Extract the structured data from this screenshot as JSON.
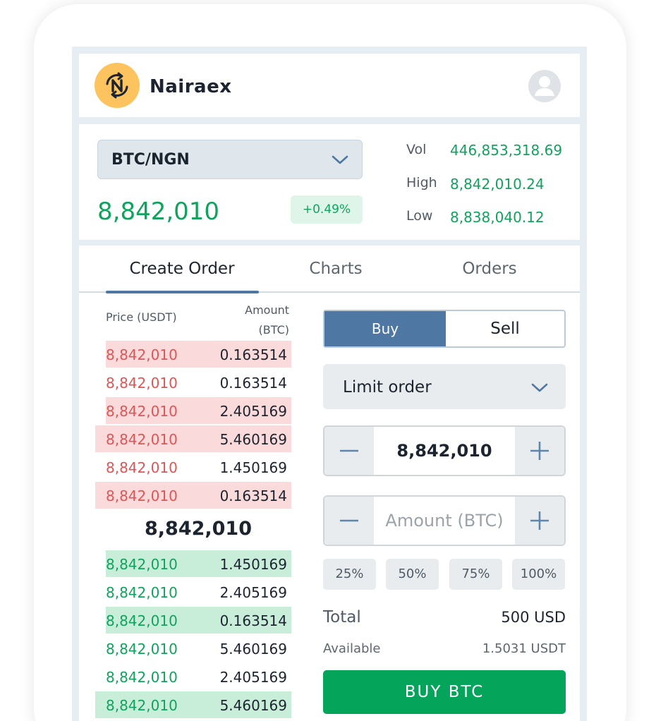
{
  "app": {
    "name": "Nairaex"
  },
  "market": {
    "pair": "BTC/NGN",
    "last_price": "8,842,010",
    "change": "+0.49%",
    "stats": [
      {
        "label": "Vol",
        "value": "446,853,318.69"
      },
      {
        "label": "High",
        "value": "8,842,010.24"
      },
      {
        "label": "Low",
        "value": "8,838,040.12"
      }
    ]
  },
  "tabs": [
    {
      "label": "Create Order",
      "active": true
    },
    {
      "label": "Charts",
      "active": false
    },
    {
      "label": "Orders",
      "active": false
    }
  ],
  "orderbook": {
    "price_header": "Price (USDT)",
    "amount_header_1": "Amount",
    "amount_header_2": "(BTC)",
    "asks": [
      {
        "price": "8,842,010",
        "amount": "0.163514"
      },
      {
        "price": "8,842,010",
        "amount": "0.163514"
      },
      {
        "price": "8,842,010",
        "amount": "2.405169"
      },
      {
        "price": "8,842,010",
        "amount": "5.460169"
      },
      {
        "price": "8,842,010",
        "amount": "1.450169"
      },
      {
        "price": "8,842,010",
        "amount": "0.163514"
      }
    ],
    "mid_price": "8,842,010",
    "bids": [
      {
        "price": "8,842,010",
        "amount": "1.450169"
      },
      {
        "price": "8,842,010",
        "amount": "2.405169"
      },
      {
        "price": "8,842,010",
        "amount": "0.163514"
      },
      {
        "price": "8,842,010",
        "amount": "5.460169"
      },
      {
        "price": "8,842,010",
        "amount": "2.405169"
      },
      {
        "price": "8,842,010",
        "amount": "5.460169"
      }
    ]
  },
  "form": {
    "buy_label": "Buy",
    "sell_label": "Sell",
    "order_type": "Limit order",
    "price_value": "8,842,010",
    "amount_placeholder": "Amount (BTC)",
    "percentages": [
      "25%",
      "50%",
      "75%",
      "100%"
    ],
    "total_label": "Total",
    "total_value": "500 USD",
    "available_label": "Available",
    "available_value": "1.5031 USDT",
    "submit_label": "BUY BTC"
  },
  "colors": {
    "brand": "#fdc35e",
    "positive": "#10a35d",
    "negative": "#e05555",
    "accent": "#4e78a3",
    "submit": "#04a45a"
  },
  "icons": {
    "logo": "nairaex-logo-icon",
    "avatar": "user-avatar-icon",
    "pair_dropdown": "chevron-down-icon",
    "order_type_dropdown": "chevron-down-icon",
    "decrement": "minus-icon",
    "increment": "plus-icon"
  }
}
